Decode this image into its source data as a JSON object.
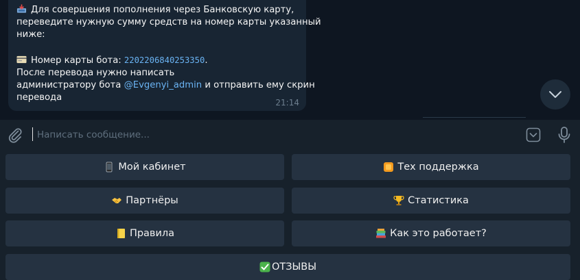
{
  "message": {
    "line1": "Для совершения пополнения через Банковскую карту,",
    "line2": "переведите нужную сумму средств на номер карты указанный",
    "line3": "ниже:",
    "card_label": "Номер карты бота: ",
    "card_number": "2202206840253350",
    "card_dot": ".",
    "line5": "После перевода нужно написать",
    "line6_prefix": "администратору бота ",
    "mention": "@Evgenyi_admin",
    "line6_suffix": " и отправить ему скрин",
    "line7": "перевода",
    "time": "21:14",
    "icons": [
      "inbox-tray-icon",
      "credit-card-icon"
    ]
  },
  "composer": {
    "placeholder": "Написать сообщение..."
  },
  "keyboard": {
    "buttons": [
      {
        "label": "Мой кабинет",
        "icon": "mobile-phone-icon"
      },
      {
        "label": "Тех поддержка",
        "icon": "orange-box-icon"
      },
      {
        "label": "Партнёры",
        "icon": "handshake-icon"
      },
      {
        "label": "Статистика",
        "icon": "trophy-icon"
      },
      {
        "label": "Правила",
        "icon": "notebook-icon"
      },
      {
        "label": "Как это работает?",
        "icon": "books-icon"
      },
      {
        "label": "ОТЗЫВЫ",
        "icon": "check-mark-icon"
      }
    ]
  },
  "colors": {
    "background": "#0e1621",
    "bubble": "#182533",
    "link": "#6ab3f3",
    "button": "#253241",
    "bar": "#17212b"
  }
}
